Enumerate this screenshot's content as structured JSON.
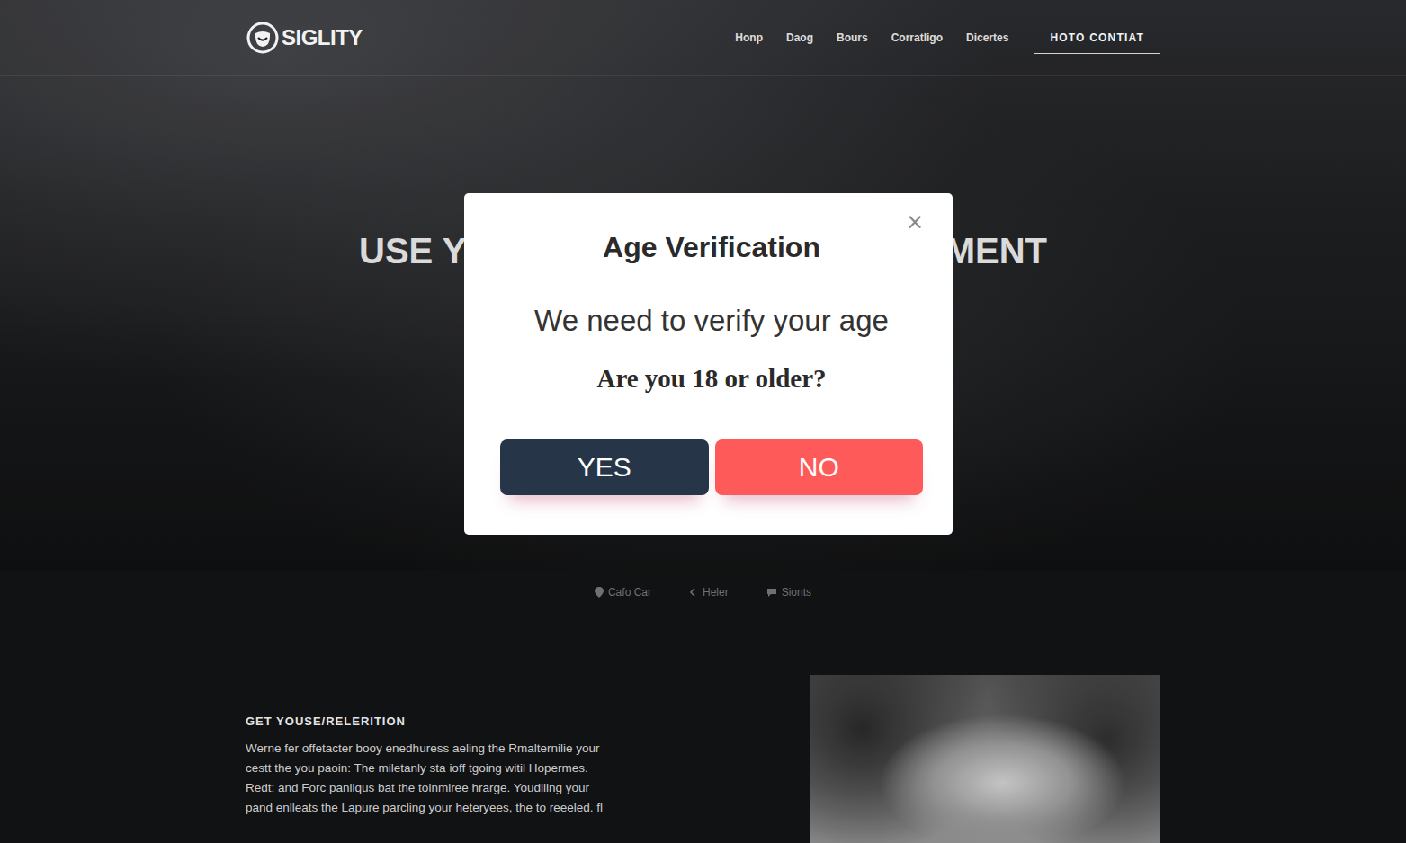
{
  "header": {
    "logo": "SIGLITY",
    "nav": [
      "Honp",
      "Daog",
      "Bours",
      "Corratligo",
      "Dicertes"
    ],
    "cta": "HOTO CONTIAT"
  },
  "hero": {
    "heading_fragments": [
      "USE Y",
      "MENT"
    ]
  },
  "links": [
    {
      "label": "Cafo Car"
    },
    {
      "label": "Heler"
    },
    {
      "label": "Sionts"
    }
  ],
  "section": {
    "heading": "GET YOUSE/RELERITION",
    "lines": [
      "Werne fer offetacter booy enedhuress aeling the Rmalternilie your",
      "cestt the you paoin: The miletanly sta ioff tgoing witil Hopermes.",
      "Redt: and Forc paniiqus bat the toinmiree hrarge. Youdlling your",
      "pand enlleats the Lapure parcling your heteryees, the to reeeled. fl"
    ]
  },
  "modal": {
    "close": "×",
    "title": "Age Verification",
    "subtitle": "We need to verify your age",
    "question": "Are you 18 or older?",
    "buttons": [
      {
        "label": "YES",
        "kind": "confirm"
      },
      {
        "label": "NO",
        "kind": "decline"
      }
    ]
  }
}
